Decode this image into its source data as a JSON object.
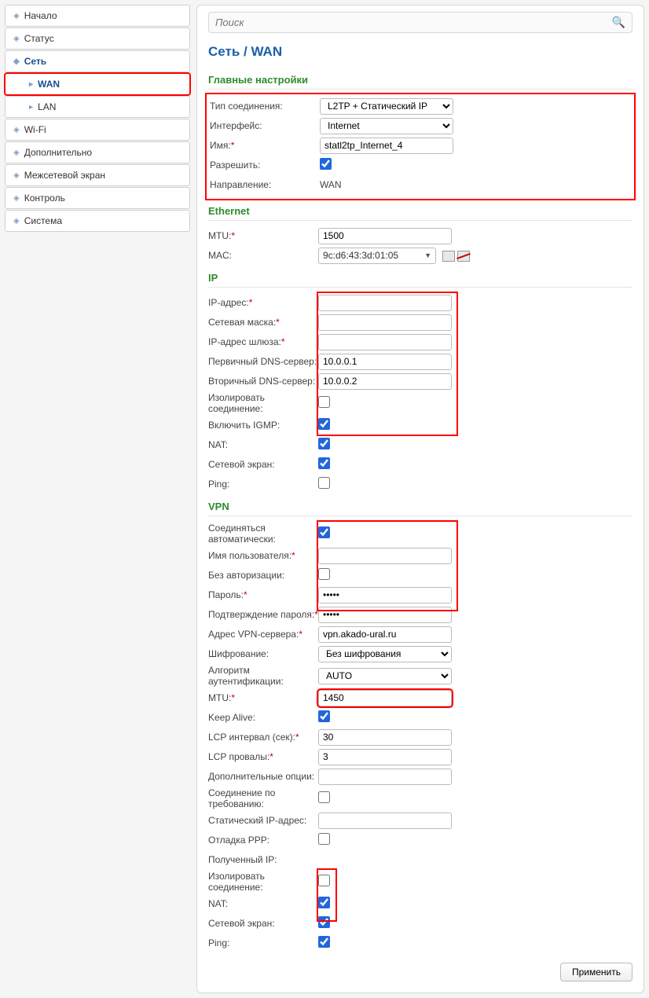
{
  "search": {
    "placeholder": "Поиск"
  },
  "nav": {
    "home": "Начало",
    "status": "Статус",
    "network": "Сеть",
    "wan": "WAN",
    "lan": "LAN",
    "wifi": "Wi-Fi",
    "advanced": "Дополнительно",
    "firewall": "Межсетевой экран",
    "control": "Контроль",
    "system": "Система"
  },
  "breadcrumb": "Сеть /  WAN",
  "sections": {
    "main": "Главные настройки",
    "ethernet": "Ethernet",
    "ip": "IP",
    "vpn": "VPN"
  },
  "main": {
    "conn_type_label": "Тип соединения:",
    "conn_type_value": "L2TP + Статический IP",
    "iface_label": "Интерфейс:",
    "iface_value": "Internet",
    "name_label": "Имя:",
    "name_value": "statl2tp_Internet_4",
    "enable_label": "Разрешить:",
    "direction_label": "Направление:",
    "direction_value": "WAN"
  },
  "eth": {
    "mtu_label": "MTU:",
    "mtu_value": "1500",
    "mac_label": "MAC:",
    "mac_value": "9c:d6:43:3d:01:05"
  },
  "ip": {
    "ip_label": "IP-адрес:",
    "mask_label": "Сетевая маска:",
    "gw_label": "IP-адрес шлюза:",
    "dns1_label": "Первичный DNS-сервер:",
    "dns1_value": "10.0.0.1",
    "dns2_label": "Вторичный DNS-сервер:",
    "dns2_value": "10.0.0.2",
    "isolate_label": "Изолировать соединение:",
    "igmp_label": "Включить IGMP:",
    "nat_label": "NAT:",
    "fw_label": "Сетевой экран:",
    "ping_label": "Ping:"
  },
  "vpn": {
    "auto_label": "Соединяться автоматически:",
    "user_label": "Имя пользователя:",
    "noauth_label": "Без авторизации:",
    "pass_label": "Пароль:",
    "pass2_label": "Подтверждение пароля:",
    "server_label": "Адрес VPN-сервера:",
    "server_value": "vpn.akado-ural.ru",
    "enc_label": "Шифрование:",
    "enc_value": "Без шифрования",
    "auth_label": "Алгоритм аутентификации:",
    "auth_value": "AUTO",
    "mtu_label": "MTU:",
    "mtu_value": "1450",
    "keepalive_label": "Keep Alive:",
    "lcp_int_label": "LCP интервал (сек):",
    "lcp_int_value": "30",
    "lcp_fail_label": "LCP провалы:",
    "lcp_fail_value": "3",
    "extra_label": "Дополнительные опции:",
    "ondemand_label": "Соединение по требованию:",
    "static_ip_label": "Статический IP-адрес:",
    "ppp_debug_label": "Отладка PPP:",
    "got_ip_label": "Полученный IP:",
    "isolate_label": "Изолировать соединение:",
    "nat_label": "NAT:",
    "fw_label": "Сетевой экран:",
    "ping_label": "Ping:"
  },
  "buttons": {
    "apply": "Применить"
  }
}
